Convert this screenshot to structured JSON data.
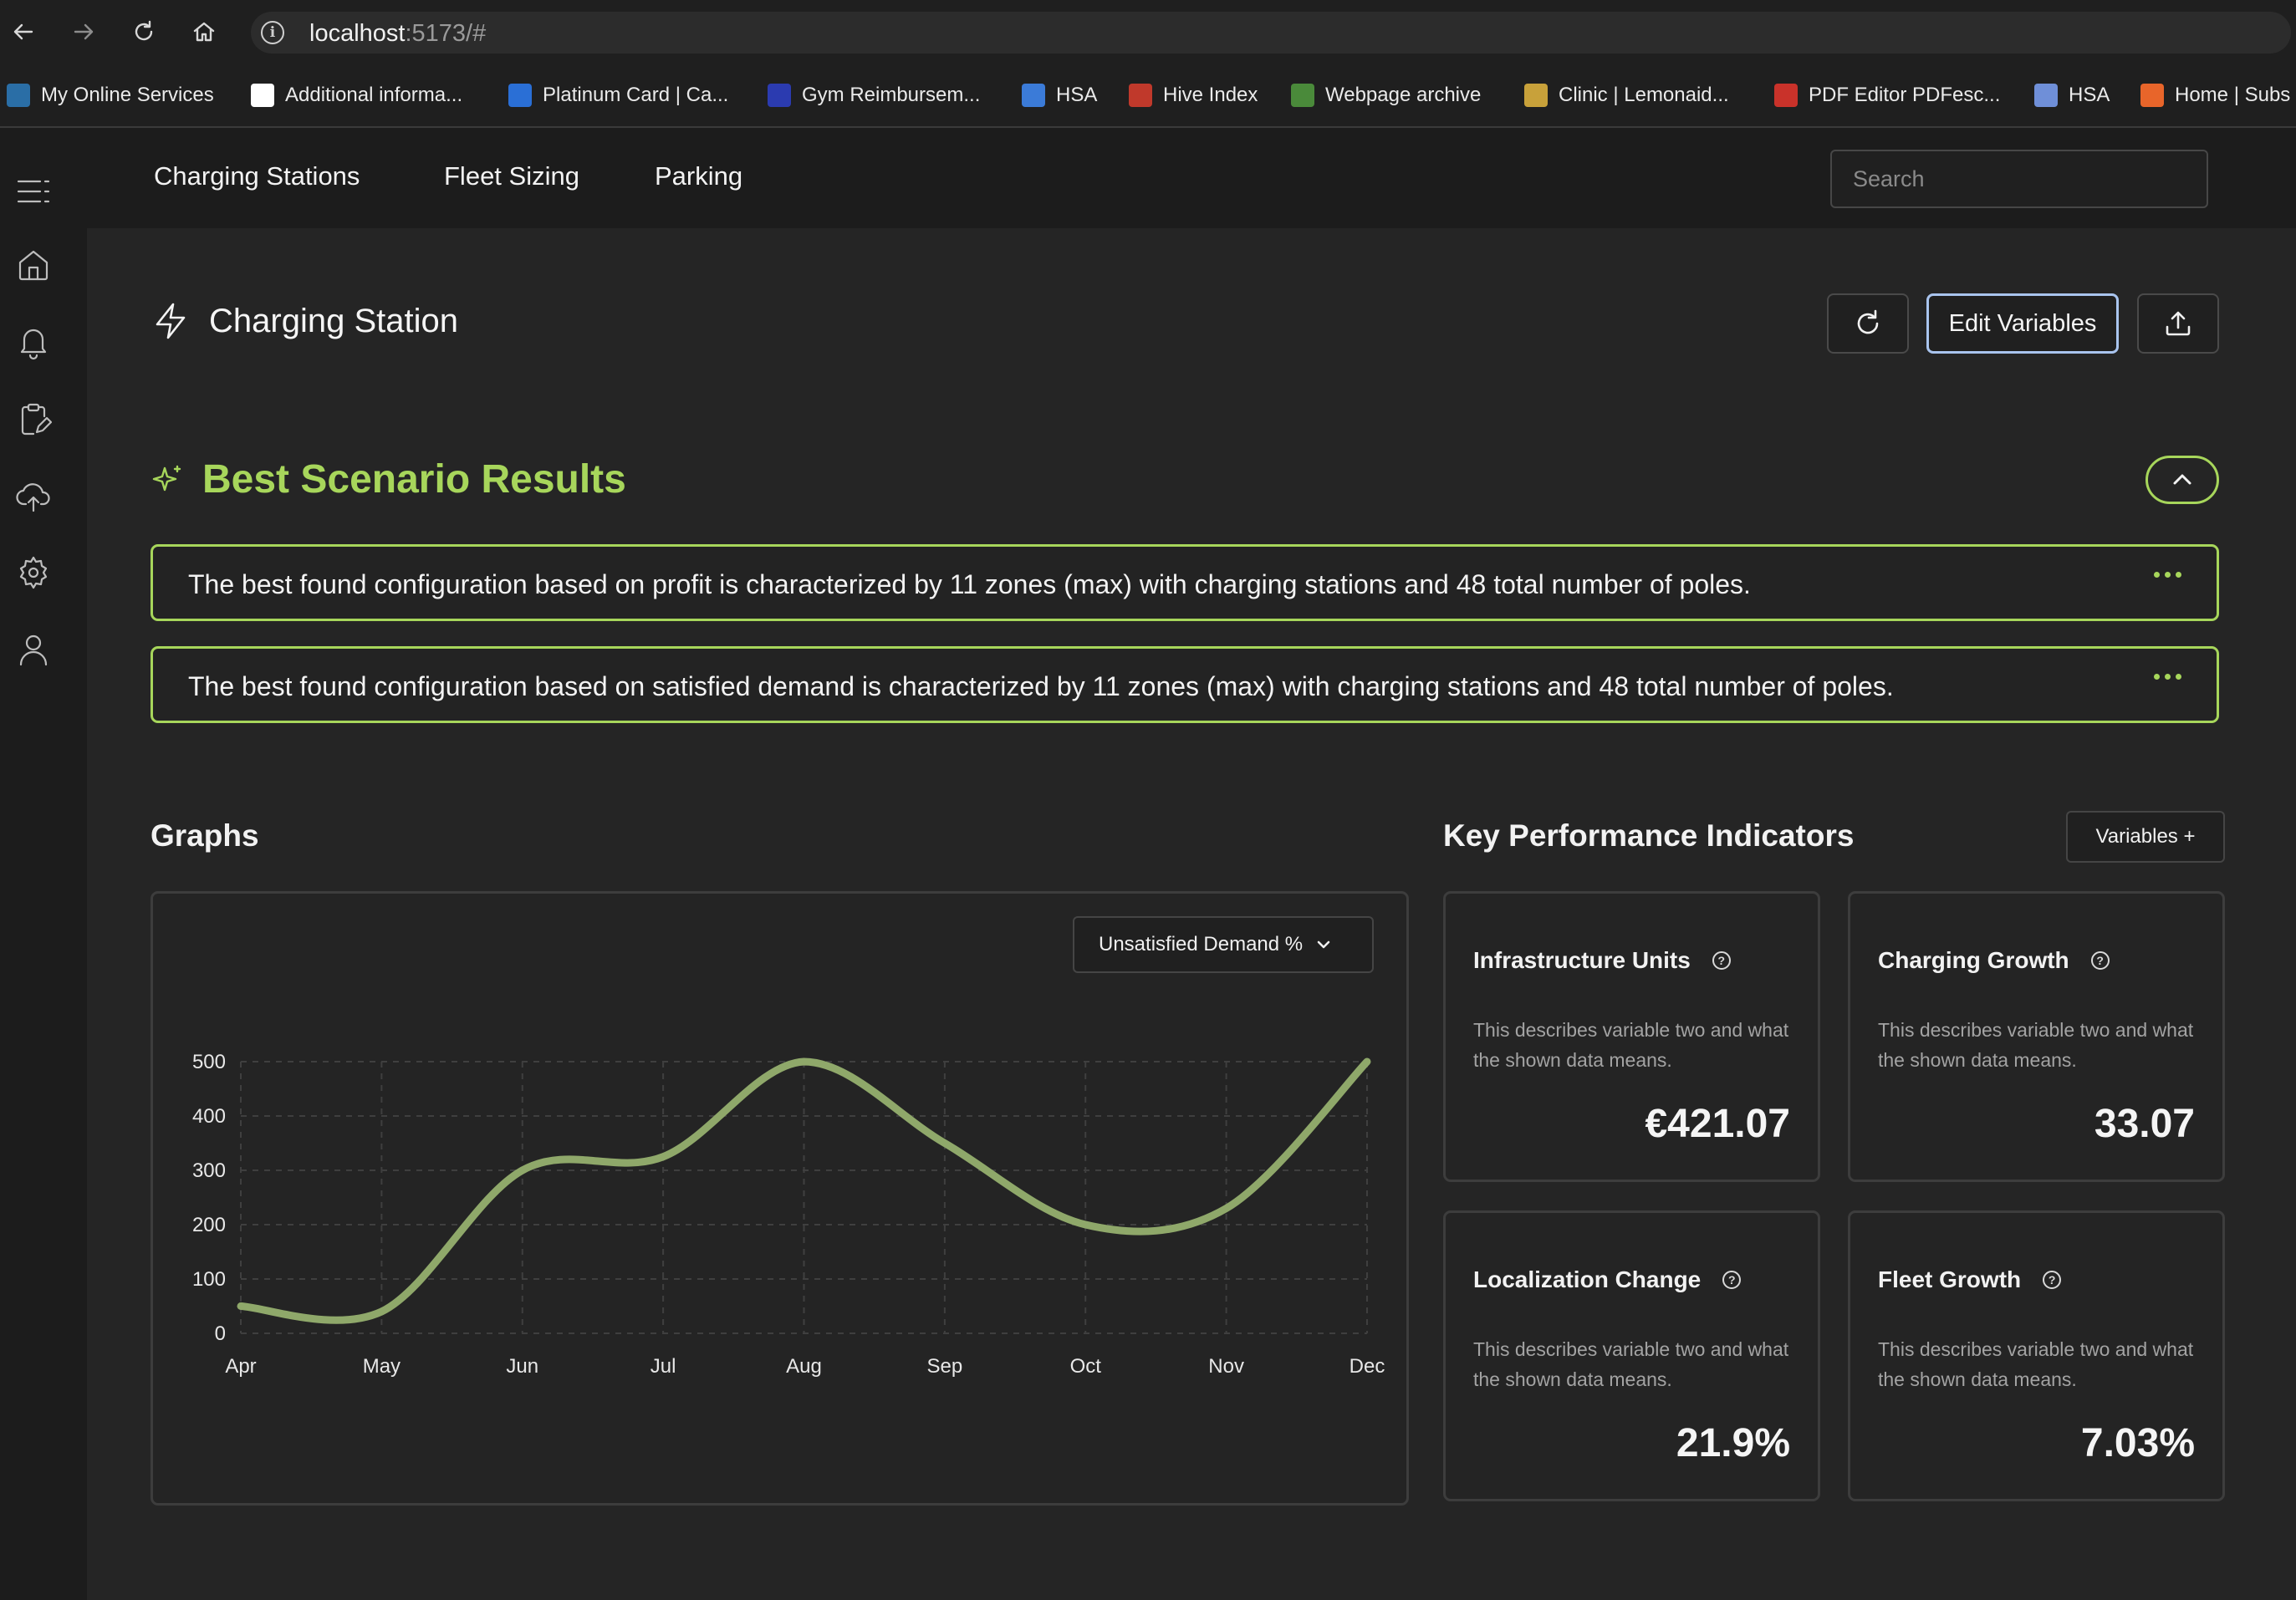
{
  "browser": {
    "url_host": "localhost",
    "url_rest": ":5173/#",
    "bookmarks": [
      {
        "label": "My Online Services",
        "icon": "ny-state-icon",
        "color": "#2a6ea6"
      },
      {
        "label": "Additional informa...",
        "icon": "ny-state-icon",
        "color": "#ffffff"
      },
      {
        "label": "Platinum Card | Ca...",
        "icon": "amex-icon",
        "color": "#2a6fd6"
      },
      {
        "label": "Gym Reimbursem...",
        "icon": "af-icon",
        "color": "#2b3bb0"
      },
      {
        "label": "HSA",
        "icon": "hsa-icon",
        "color": "#3b7bd8"
      },
      {
        "label": "Hive Index",
        "icon": "hive-icon",
        "color": "#c0392b"
      },
      {
        "label": "Webpage archive",
        "icon": "archive-icon",
        "color": "#4a8a3a"
      },
      {
        "label": "Clinic | Lemonaid...",
        "icon": "lemonaid-icon",
        "color": "#c8a13a"
      },
      {
        "label": "PDF Editor PDFesc...",
        "icon": "pdf-icon",
        "color": "#c9322a"
      },
      {
        "label": "HSA",
        "icon": "doc-icon",
        "color": "#6f8fd8"
      },
      {
        "label": "Home | Subs",
        "icon": "subs-icon",
        "color": "#e8652a"
      }
    ]
  },
  "nav": {
    "tabs": [
      "Charging Stations",
      "Fleet Sizing",
      "Parking"
    ],
    "search_placeholder": "Search"
  },
  "header": {
    "title": "Charging Station",
    "edit_label": "Edit Variables"
  },
  "scenario": {
    "title": "Best Scenario Results",
    "results": [
      "The best found configuration based on profit is characterized by 11 zones (max) with charging stations and 48 total number of poles.",
      "The best found configuration based on satisfied demand is characterized by 11 zones (max) with charging stations and 48 total number of poles."
    ]
  },
  "graphs": {
    "title": "Graphs",
    "selector": "Unsatisfied Demand %"
  },
  "chart_data": {
    "type": "line",
    "categories": [
      "Apr",
      "May",
      "Jun",
      "Jul",
      "Aug",
      "Sep",
      "Oct",
      "Nov",
      "Dec"
    ],
    "series": [
      {
        "values": [
          50,
          40,
          300,
          325,
          500,
          350,
          200,
          230,
          500
        ]
      }
    ],
    "yticks": [
      0,
      100,
      200,
      300,
      400,
      500
    ],
    "ylim": [
      0,
      500
    ],
    "grid": true,
    "color": "#8fa86a"
  },
  "kpi": {
    "title": "Key Performance Indicators",
    "variables_label": "Variables +",
    "cards": [
      {
        "title": "Infrastructure Units",
        "desc": "This describes variable two and what the shown data means.",
        "value": "€421.07"
      },
      {
        "title": "Charging Growth",
        "desc": "This describes variable two and what the shown data means.",
        "value": "33.07"
      },
      {
        "title": "Localization Change",
        "desc": "This describes variable two and what the shown data means.",
        "value": "21.9%"
      },
      {
        "title": "Fleet Growth",
        "desc": "This describes variable two and what the shown data means.",
        "value": "7.03%"
      }
    ]
  }
}
